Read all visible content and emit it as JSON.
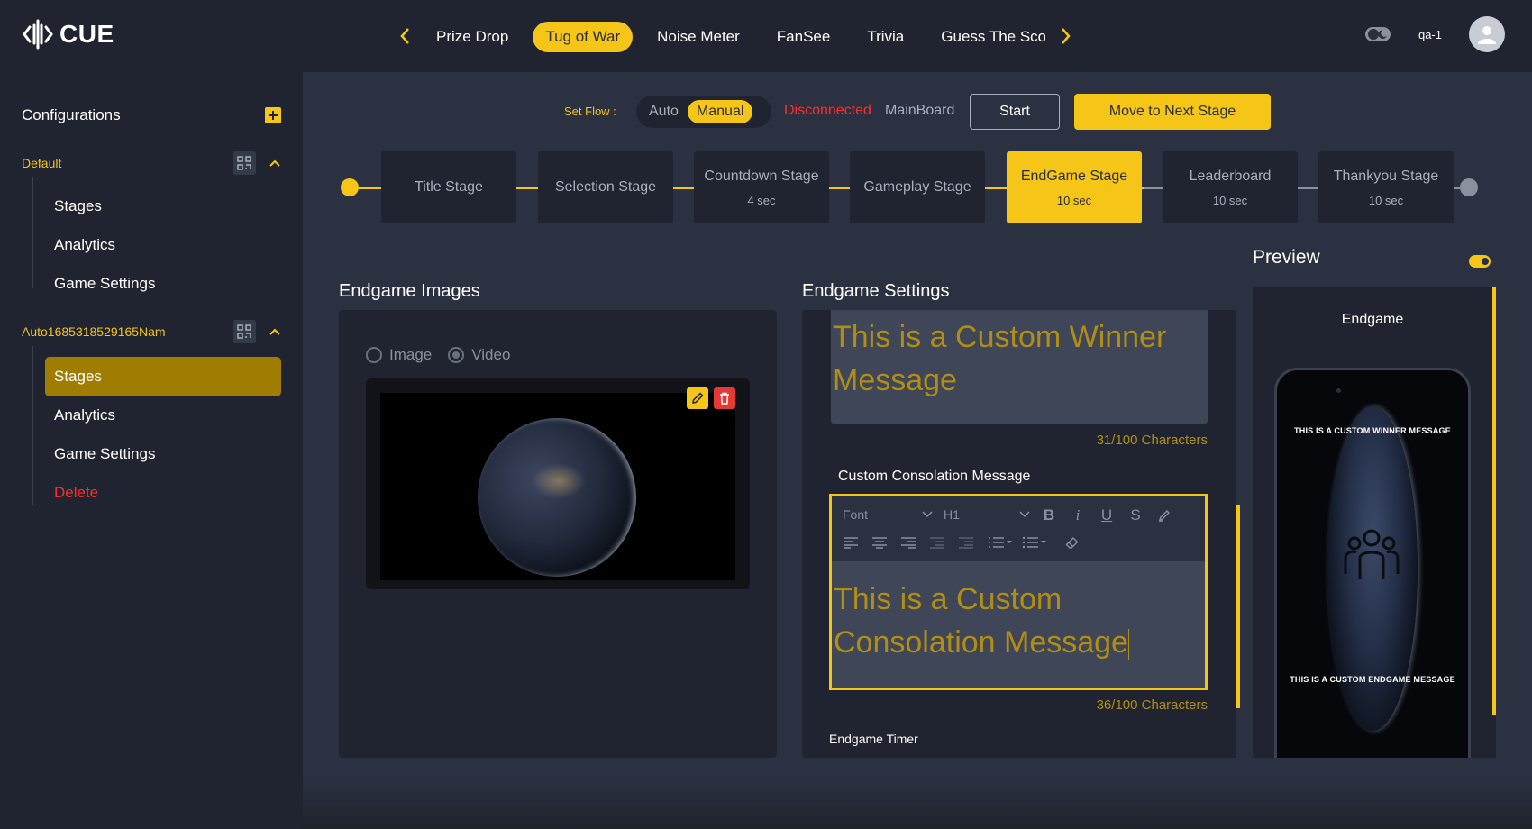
{
  "app": {
    "brand": "CUE",
    "brand_color": "#f5c518"
  },
  "header": {
    "game_tabs": [
      {
        "label": "Prize Drop",
        "active": false
      },
      {
        "label": "Tug of War",
        "active": true
      },
      {
        "label": "Noise Meter",
        "active": false
      },
      {
        "label": "FanSee",
        "active": false
      },
      {
        "label": "Trivia",
        "active": false
      },
      {
        "label": "Guess The Sco",
        "active": false
      }
    ],
    "theme_icon": "toggle-icon",
    "user_label": "qa-1"
  },
  "sidebar": {
    "title": "Configurations",
    "groups": [
      {
        "name": "Default",
        "items": [
          "Stages",
          "Analytics",
          "Game Settings"
        ]
      },
      {
        "name": "Auto1685318529165Nam",
        "items": [
          "Stages",
          "Analytics",
          "Game Settings",
          "Delete"
        ],
        "active_item": "Stages"
      }
    ]
  },
  "flow": {
    "label": "Set Flow :",
    "options": [
      "Auto",
      "Manual"
    ],
    "selected": "Manual",
    "status": "Disconnected",
    "board": "MainBoard",
    "start_label": "Start",
    "next_label": "Move to Next Stage"
  },
  "stages": [
    {
      "name": "Title Stage",
      "time": ""
    },
    {
      "name": "Selection Stage",
      "time": ""
    },
    {
      "name": "Countdown Stage",
      "time": "4 sec"
    },
    {
      "name": "Gameplay Stage",
      "time": ""
    },
    {
      "name": "EndGame Stage",
      "time": "10 sec",
      "active": true
    },
    {
      "name": "Leaderboard",
      "time": "10 sec"
    },
    {
      "name": "Thankyou Stage",
      "time": "10 sec"
    }
  ],
  "images_panel": {
    "title": "Endgame Images",
    "options": [
      "Image",
      "Video"
    ],
    "selected": "Video"
  },
  "settings_panel": {
    "title": "Endgame Settings",
    "winner_message": "This is a Custom Winner Message",
    "winner_count": "31/100 Characters",
    "consolation_label": "Custom Consolation Message",
    "toolbar": {
      "font": "Font",
      "heading": "H1"
    },
    "consolation_message": "This is a Custom Consolation Message",
    "consolation_count": "36/100 Characters",
    "timer_label": "Endgame Timer"
  },
  "preview": {
    "title": "Preview",
    "label": "Endgame",
    "winner_text": "This is a Custom Winner Message",
    "endgame_text": "This is a Custom Endgame Message"
  }
}
